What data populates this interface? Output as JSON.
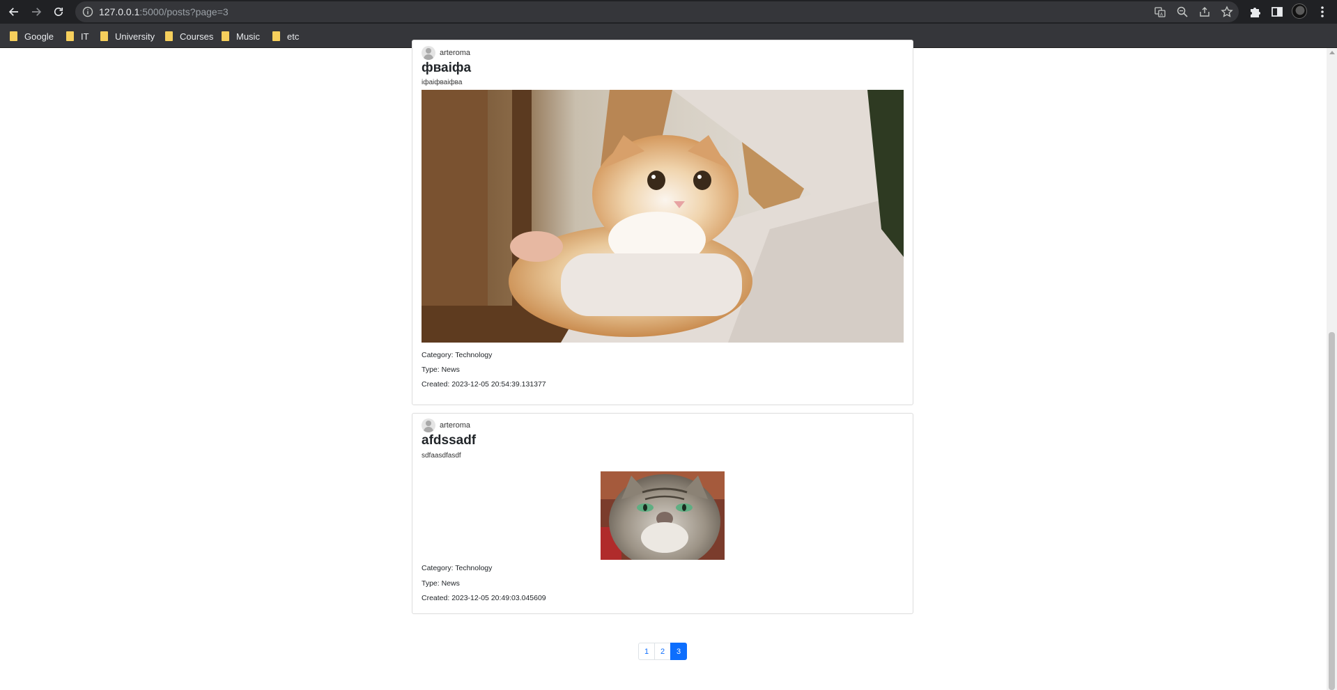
{
  "browser": {
    "url_host": "127.0.0.1",
    "url_rest": ":5000/posts?page=3",
    "bookmarks": [
      {
        "label": "Google"
      },
      {
        "label": "IT"
      },
      {
        "label": "University"
      },
      {
        "label": "Courses"
      },
      {
        "label": "Music"
      },
      {
        "label": "etc"
      }
    ]
  },
  "posts": [
    {
      "author": "arteroma",
      "title": "фваіфа",
      "body": "іфаіфваіфва",
      "category": "Category: Technology",
      "type": "Type: News",
      "created": "Created: 2023-12-05 20:54:39.131377"
    },
    {
      "author": "arteroma",
      "title": "afdssadf",
      "body": "sdfaasdfasdf",
      "category": "Category: Technology",
      "type": "Type: News",
      "created": "Created: 2023-12-05 20:49:03.045609"
    }
  ],
  "pagination": {
    "pages": [
      "1",
      "2",
      "3"
    ],
    "current": "3"
  },
  "colors": {
    "accent": "#0d6efd",
    "chrome_dark": "#202124",
    "chrome_mid": "#35363a"
  }
}
